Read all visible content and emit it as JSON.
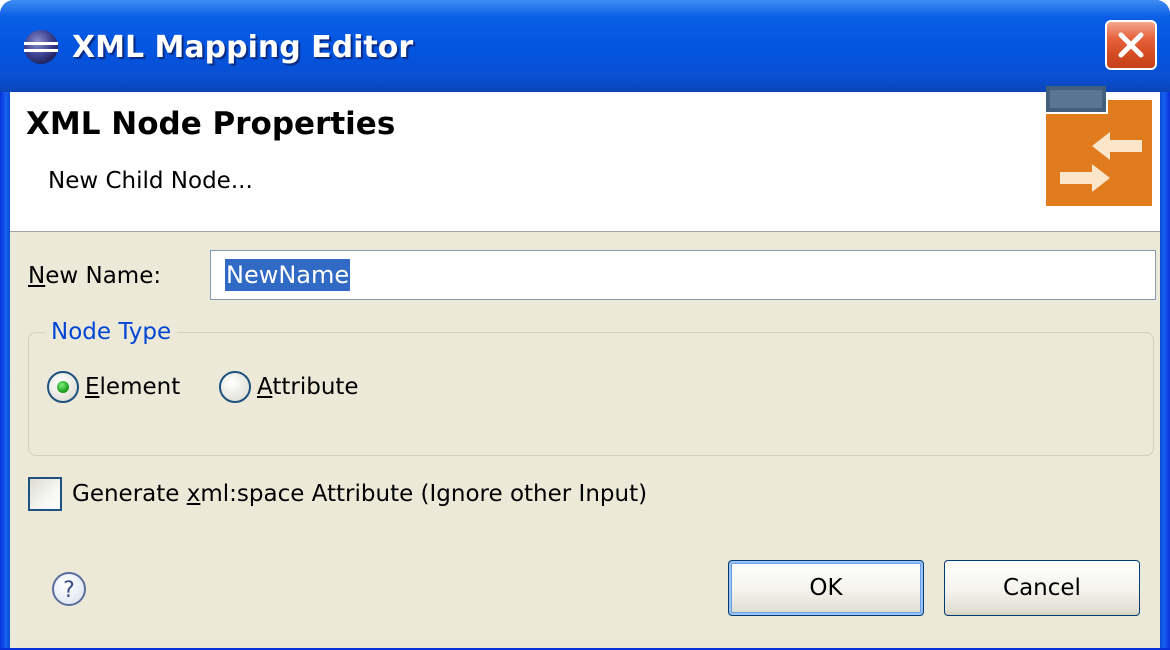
{
  "window": {
    "title": "XML Mapping Editor",
    "title_color": "#ffffff",
    "titlebar_color": "#0354e0"
  },
  "banner": {
    "title": "XML Node Properties",
    "subtitle": "New Child Node..."
  },
  "form": {
    "name_label_prefix": "N",
    "name_label_rest": "ew Name:",
    "name_value": "NewName"
  },
  "node_type": {
    "legend": "Node Type",
    "options": [
      {
        "mnemonic": "E",
        "rest": "lement",
        "selected": true
      },
      {
        "mnemonic": "A",
        "rest": "ttribute",
        "selected": false
      }
    ]
  },
  "checkbox": {
    "label_before": "Generate ",
    "label_mnemonic": "x",
    "label_after": "ml:space Attribute (Ignore other Input)",
    "checked": false
  },
  "buttons": {
    "ok": "OK",
    "cancel": "Cancel"
  },
  "icons": {
    "app": "eclipse-icon",
    "close": "close-icon",
    "help": "help-icon",
    "wizard": "xml-mapping-wizard-icon"
  },
  "colors": {
    "dialog_bg": "#ece9d8",
    "selection": "#316ac5",
    "legend": "#0046d5",
    "accent_orange": "#e07b1e"
  }
}
